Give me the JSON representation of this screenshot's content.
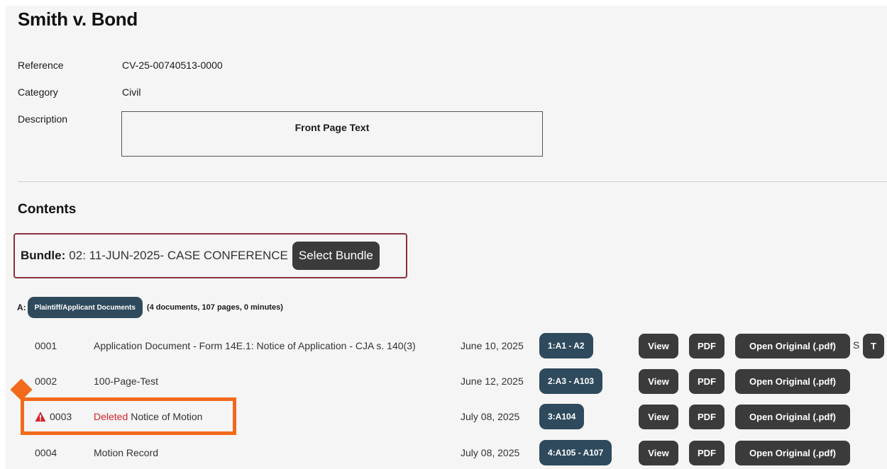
{
  "case": {
    "title": "Smith v. Bond",
    "reference_label": "Reference",
    "reference_value": "CV-25-00740513-0000",
    "category_label": "Category",
    "category_value": "Civil",
    "description_label": "Description",
    "description_value": "Front Page Text"
  },
  "contents": {
    "heading": "Contents",
    "bundle_label": "Bundle:",
    "bundle_value": "02: 11-JUN-2025- CASE CONFERENCE",
    "select_bundle_label": "Select Bundle"
  },
  "section_a": {
    "label": "A:",
    "tag": "Plaintiff/Applicant Documents",
    "stats": "(4 documents, 107 pages, 0 minutes)"
  },
  "buttons": {
    "view": "View",
    "pdf": "PDF",
    "open_original": "Open Original (.pdf)",
    "s": "S",
    "t": "T"
  },
  "documents": [
    {
      "num": "0001",
      "title": "Application Document - Form 14E.1: Notice of Application - CJA s. 140(3)",
      "date": "June 10, 2025",
      "pages": "1:A1 - A2"
    },
    {
      "num": "0002",
      "title": "100-Page-Test",
      "date": "June 12, 2025",
      "pages": "2:A3 - A103"
    },
    {
      "num": "0003",
      "deleted_label": "Deleted",
      "title": "Notice of Motion",
      "date": "July 08, 2025",
      "pages": "3:A104",
      "status": "deleted"
    },
    {
      "num": "0004",
      "title": "Motion Record",
      "date": "July 08, 2025",
      "pages": "4:A105 - A107"
    }
  ],
  "colors": {
    "accent_navy": "#2e4a5c",
    "button_dark": "#3b3b3b",
    "bundle_border": "#8c2f3d",
    "deleted_red": "#d1242f",
    "highlight_orange": "#f26a1b"
  }
}
